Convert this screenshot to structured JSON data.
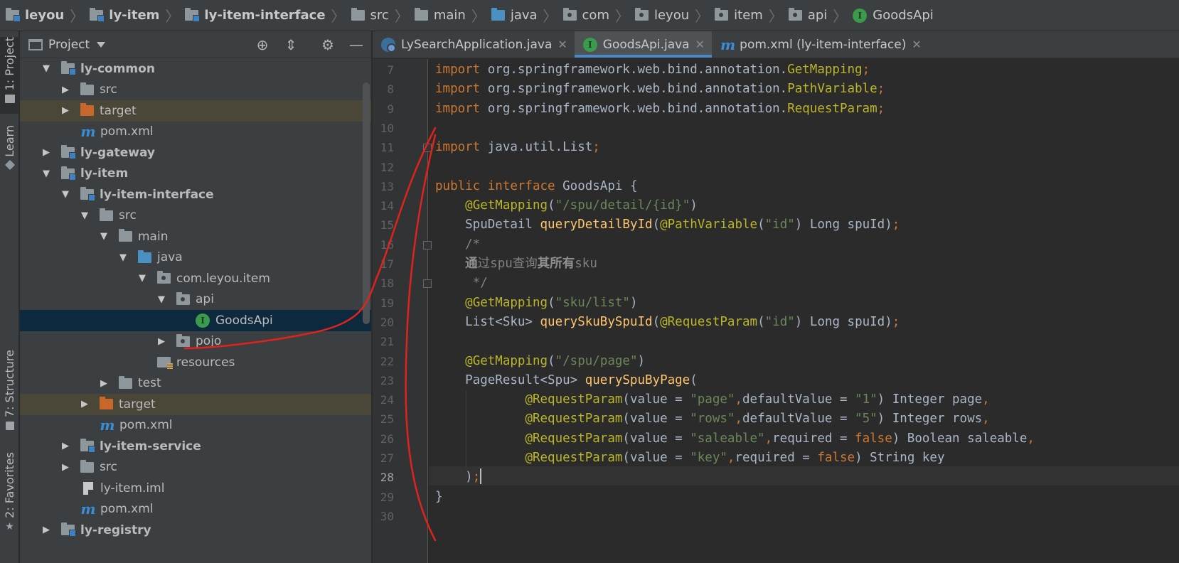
{
  "breadcrumb": [
    "leyou",
    "ly-item",
    "ly-item-interface",
    "src",
    "main",
    "java",
    "com",
    "leyou",
    "item",
    "api",
    "GoodsApi"
  ],
  "left_strip": {
    "project_tab": "1: Project",
    "learn_tab": "Learn",
    "structure_tab": "7: Structure",
    "favorites_tab": "2: Favorites"
  },
  "project_panel": {
    "title": "Project",
    "tree": [
      {
        "label": "ly-common",
        "depth": 0,
        "expanded": true,
        "icon": "module-folder",
        "bold": true
      },
      {
        "label": "src",
        "depth": 1,
        "expanded": false,
        "icon": "folder"
      },
      {
        "label": "target",
        "depth": 1,
        "expanded": false,
        "icon": "target-folder"
      },
      {
        "label": "pom.xml",
        "depth": 1,
        "icon": "maven-file"
      },
      {
        "label": "ly-gateway",
        "depth": 0,
        "expanded": false,
        "icon": "module-folder",
        "bold": true
      },
      {
        "label": "ly-item",
        "depth": 0,
        "expanded": true,
        "icon": "module-folder",
        "bold": true
      },
      {
        "label": "ly-item-interface",
        "depth": 1,
        "expanded": true,
        "icon": "module-folder",
        "bold": true
      },
      {
        "label": "src",
        "depth": 2,
        "expanded": true,
        "icon": "folder"
      },
      {
        "label": "main",
        "depth": 3,
        "expanded": true,
        "icon": "folder"
      },
      {
        "label": "java",
        "depth": 4,
        "expanded": true,
        "icon": "source-folder"
      },
      {
        "label": "com.leyou.item",
        "depth": 5,
        "expanded": true,
        "icon": "package"
      },
      {
        "label": "api",
        "depth": 6,
        "expanded": true,
        "icon": "package"
      },
      {
        "label": "GoodsApi",
        "depth": 7,
        "icon": "interface",
        "selected": true
      },
      {
        "label": "pojo",
        "depth": 6,
        "expanded": false,
        "icon": "package"
      },
      {
        "label": "resources",
        "depth": 5,
        "icon": "resources-folder"
      },
      {
        "label": "test",
        "depth": 3,
        "expanded": false,
        "icon": "folder"
      },
      {
        "label": "target",
        "depth": 2,
        "expanded": false,
        "icon": "target-folder"
      },
      {
        "label": "pom.xml",
        "depth": 2,
        "icon": "maven-file"
      },
      {
        "label": "ly-item-service",
        "depth": 1,
        "expanded": false,
        "icon": "module-folder",
        "bold": true
      },
      {
        "label": "src",
        "depth": 1,
        "expanded": false,
        "icon": "folder"
      },
      {
        "label": "ly-item.iml",
        "depth": 1,
        "icon": "iml-file"
      },
      {
        "label": "pom.xml",
        "depth": 1,
        "icon": "maven-file"
      },
      {
        "label": "ly-registry",
        "depth": 0,
        "expanded": false,
        "icon": "module-folder",
        "bold": true
      }
    ]
  },
  "tabs": [
    {
      "label": "LySearchApplication.java",
      "icon": "spring-app-icon",
      "active": false
    },
    {
      "label": "GoodsApi.java",
      "icon": "interface-icon",
      "active": true
    },
    {
      "label": "pom.xml (ly-item-interface)",
      "icon": "maven-icon",
      "active": false
    }
  ],
  "editor": {
    "current_line": 28,
    "lines": [
      {
        "n": 7,
        "tokens": [
          [
            "kw",
            "import "
          ],
          [
            "",
            "org.springframework.web.bind.annotation."
          ],
          [
            "an",
            "GetMapping"
          ],
          [
            "kw",
            ";"
          ]
        ]
      },
      {
        "n": 8,
        "tokens": [
          [
            "kw",
            "import "
          ],
          [
            "",
            "org.springframework.web.bind.annotation."
          ],
          [
            "an",
            "PathVariable"
          ],
          [
            "kw",
            ";"
          ]
        ]
      },
      {
        "n": 9,
        "tokens": [
          [
            "kw",
            "import "
          ],
          [
            "",
            "org.springframework.web.bind.annotation."
          ],
          [
            "an",
            "RequestParam"
          ],
          [
            "kw",
            ";"
          ]
        ]
      },
      {
        "n": 10,
        "tokens": []
      },
      {
        "n": 11,
        "tokens": [
          [
            "kw",
            "import "
          ],
          [
            "",
            "java.util.List"
          ],
          [
            "kw",
            ";"
          ]
        ]
      },
      {
        "n": 12,
        "tokens": []
      },
      {
        "n": 13,
        "tokens": [
          [
            "kw",
            "public interface "
          ],
          [
            "",
            "GoodsApi {"
          ]
        ]
      },
      {
        "n": 14,
        "tokens": [
          [
            "",
            "    "
          ],
          [
            "an",
            "@GetMapping"
          ],
          [
            "",
            "("
          ],
          [
            "st",
            "\"/spu/detail/{id}\""
          ],
          [
            "",
            ")"
          ]
        ]
      },
      {
        "n": 15,
        "tokens": [
          [
            "",
            "    SpuDetail "
          ],
          [
            "fn",
            "queryDetailById"
          ],
          [
            "",
            "("
          ],
          [
            "an",
            "@PathVariable"
          ],
          [
            "",
            "("
          ],
          [
            "st",
            "\"id\""
          ],
          [
            "",
            ") Long spuId)"
          ],
          [
            "kw",
            ";"
          ]
        ]
      },
      {
        "n": 16,
        "tokens": [
          [
            "cm",
            "    /*"
          ]
        ]
      },
      {
        "n": 17,
        "tokens": [
          [
            "cm",
            "    "
          ],
          [
            "cmb",
            "通"
          ],
          [
            "cm",
            "过spu查询"
          ],
          [
            "cmb",
            "其所有"
          ],
          [
            "cm",
            "sku"
          ]
        ]
      },
      {
        "n": 18,
        "tokens": [
          [
            "cm",
            "     */"
          ]
        ]
      },
      {
        "n": 19,
        "tokens": [
          [
            "",
            "    "
          ],
          [
            "an",
            "@GetMapping"
          ],
          [
            "",
            "("
          ],
          [
            "st",
            "\"sku/list\""
          ],
          [
            "",
            ")"
          ]
        ]
      },
      {
        "n": 20,
        "tokens": [
          [
            "",
            "    List<Sku> "
          ],
          [
            "fn",
            "querySkuBySpuId"
          ],
          [
            "",
            "("
          ],
          [
            "an",
            "@RequestParam"
          ],
          [
            "",
            "("
          ],
          [
            "st",
            "\"id\""
          ],
          [
            "",
            ") Long spuId)"
          ],
          [
            "kw",
            ";"
          ]
        ]
      },
      {
        "n": 21,
        "tokens": []
      },
      {
        "n": 22,
        "tokens": [
          [
            "",
            "    "
          ],
          [
            "an",
            "@GetMapping"
          ],
          [
            "",
            "("
          ],
          [
            "st",
            "\"/spu/page\""
          ],
          [
            "",
            ")"
          ]
        ]
      },
      {
        "n": 23,
        "tokens": [
          [
            "",
            "    PageResult<Spu> "
          ],
          [
            "fn",
            "querySpuByPage"
          ],
          [
            "",
            "("
          ]
        ]
      },
      {
        "n": 24,
        "tokens": [
          [
            "",
            "            "
          ],
          [
            "an",
            "@RequestParam"
          ],
          [
            "",
            "(value = "
          ],
          [
            "st",
            "\"page\""
          ],
          [
            "kw",
            ","
          ],
          [
            "",
            "defaultValue = "
          ],
          [
            "st",
            "\"1\""
          ],
          [
            "",
            ") Integer page"
          ],
          [
            "kw",
            ","
          ]
        ]
      },
      {
        "n": 25,
        "tokens": [
          [
            "",
            "            "
          ],
          [
            "an",
            "@RequestParam"
          ],
          [
            "",
            "(value = "
          ],
          [
            "st",
            "\"rows\""
          ],
          [
            "kw",
            ","
          ],
          [
            "",
            "defaultValue = "
          ],
          [
            "st",
            "\"5\""
          ],
          [
            "",
            ") Integer rows"
          ],
          [
            "kw",
            ","
          ]
        ]
      },
      {
        "n": 26,
        "tokens": [
          [
            "",
            "            "
          ],
          [
            "an",
            "@RequestParam"
          ],
          [
            "",
            "(value = "
          ],
          [
            "st",
            "\"saleable\""
          ],
          [
            "kw",
            ","
          ],
          [
            "",
            "required = "
          ],
          [
            "kw",
            "false"
          ],
          [
            "",
            ") Boolean saleable"
          ],
          [
            "kw",
            ","
          ]
        ]
      },
      {
        "n": 27,
        "tokens": [
          [
            "",
            "            "
          ],
          [
            "an",
            "@RequestParam"
          ],
          [
            "",
            "(value = "
          ],
          [
            "st",
            "\"key\""
          ],
          [
            "kw",
            ","
          ],
          [
            "",
            "required = "
          ],
          [
            "kw",
            "false"
          ],
          [
            "",
            ") String key"
          ]
        ]
      },
      {
        "n": 28,
        "tokens": [
          [
            "",
            "    )"
          ],
          [
            "kw",
            ";"
          ]
        ]
      },
      {
        "n": 29,
        "tokens": [
          [
            "",
            "}"
          ]
        ]
      },
      {
        "n": 30,
        "tokens": []
      }
    ]
  },
  "colors": {
    "keyword": "#cc7832",
    "annotation": "#bbb529",
    "string": "#6a8759",
    "method": "#ffc66d",
    "comment": "#808080",
    "default": "#a9b7c6",
    "selection": "#0d293e",
    "annotation_stroke": "#e0231c"
  }
}
